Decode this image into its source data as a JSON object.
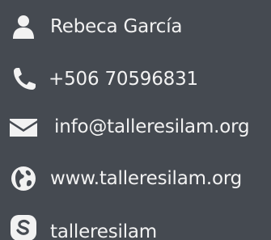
{
  "contact": {
    "name": "Rebeca García",
    "phone": "+506 70596831",
    "email": "info@talleresilam.org",
    "website": "www.talleresilam.org",
    "skype": "talleresilam"
  },
  "icons": {
    "name": "user-icon",
    "phone": "phone-icon",
    "email": "envelope-icon",
    "website": "globe-icon",
    "skype": "skype-icon"
  },
  "colors": {
    "background": "#454a51",
    "foreground": "#f2f2f2"
  }
}
